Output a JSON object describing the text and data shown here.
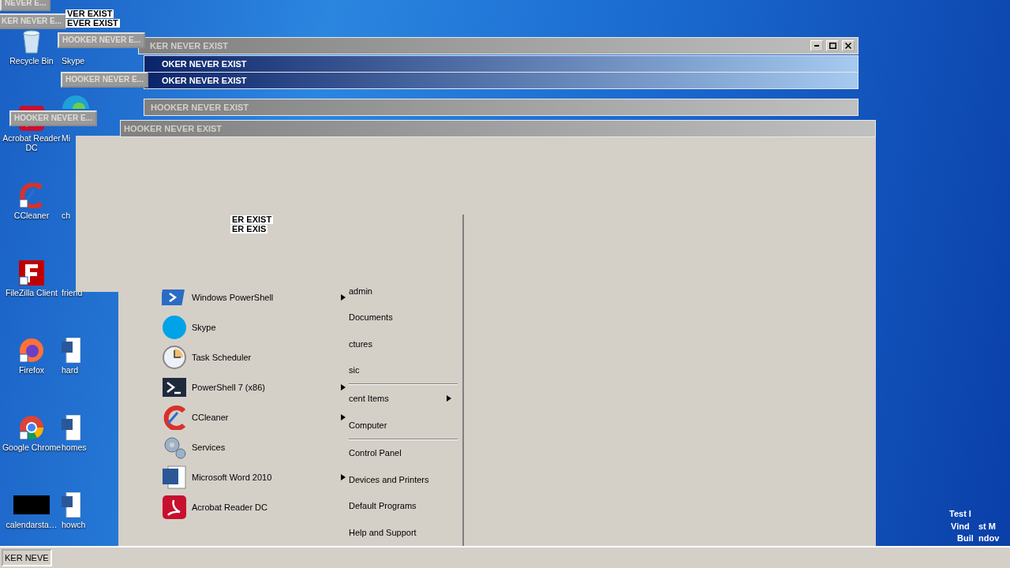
{
  "desktop_icons": [
    {
      "label": "Recycle Bin"
    },
    {
      "label": "Skype"
    },
    {
      "label": "Acrobat Reader DC"
    },
    {
      "label": "Mi"
    },
    {
      "label": "CCleaner"
    },
    {
      "label": "ch"
    },
    {
      "label": "FileZilla Client"
    },
    {
      "label": "friend"
    },
    {
      "label": "Firefox"
    },
    {
      "label": "hard"
    },
    {
      "label": "Google Chrome"
    },
    {
      "label": "homes"
    },
    {
      "label": "calendarsta…"
    },
    {
      "label": "howch"
    }
  ],
  "windows": [
    {
      "title": "KER NEVER EXIST",
      "active": false,
      "controls": true
    },
    {
      "title": "OKER NEVER EXIST",
      "active": true,
      "controls": false
    },
    {
      "title": "OKER NEVER EXIST",
      "active": true,
      "controls": false
    },
    {
      "title": "HOOKER NEVER EXIST",
      "active": false,
      "controls": false
    },
    {
      "title": "HOOKER NEVER EXIST",
      "active": false,
      "controls": false
    }
  ],
  "minimized_windows": [
    {
      "title": "NEVER E..."
    },
    {
      "title": "KER NEVER E..."
    },
    {
      "title": "HOOKER NEVER E..."
    },
    {
      "title": "HOOKER NEVER E..."
    },
    {
      "title": "HOOKER NEVER E..."
    }
  ],
  "fragments": [
    {
      "text": "VER EXIST"
    },
    {
      "text": "EVER EXIST"
    },
    {
      "text": "ER EXIST"
    },
    {
      "text": "ER EXIS"
    }
  ],
  "start_menu": {
    "programs": [
      {
        "label": "Windows PowerShell",
        "submenu": true
      },
      {
        "label": "Skype",
        "submenu": false
      },
      {
        "label": "Task Scheduler",
        "submenu": false
      },
      {
        "label": "PowerShell 7 (x86)",
        "submenu": true
      },
      {
        "label": "CCleaner",
        "submenu": true
      },
      {
        "label": "Services",
        "submenu": false
      },
      {
        "label": "Microsoft Word 2010",
        "submenu": true
      },
      {
        "label": "Acrobat Reader DC",
        "submenu": false
      }
    ],
    "places": [
      {
        "label": "admin",
        "submenu": false,
        "separator_after": false
      },
      {
        "label": "Documents",
        "submenu": false,
        "separator_after": false
      },
      {
        "label": "ctures",
        "submenu": false,
        "separator_after": false
      },
      {
        "label": "sic",
        "submenu": false,
        "separator_after": true
      },
      {
        "label": "cent Items",
        "submenu": true,
        "separator_after": false
      },
      {
        "label": "Computer",
        "submenu": false,
        "separator_after": true
      },
      {
        "label": "Control Panel",
        "submenu": false,
        "separator_after": false
      },
      {
        "label": "Devices and Printers",
        "submenu": false,
        "separator_after": false
      },
      {
        "label": "Default Programs",
        "submenu": false,
        "separator_after": false
      },
      {
        "label": "Help and Support",
        "submenu": false,
        "separator_after": false
      }
    ]
  },
  "desktop_info": [
    {
      "text": "Test I"
    },
    {
      "text": "Vind"
    },
    {
      "text": "st M"
    },
    {
      "text": "Buil"
    },
    {
      "text": "ndov"
    }
  ],
  "taskbar": {
    "buttons": [
      {
        "label": "KER NEVE"
      }
    ]
  }
}
